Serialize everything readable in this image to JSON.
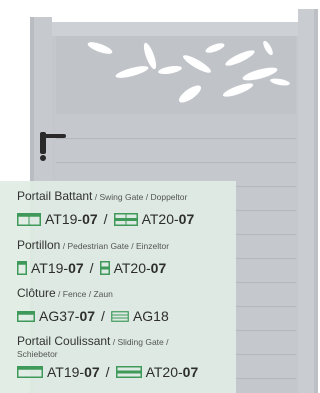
{
  "colors": {
    "gate_gray": "#c7cbd0",
    "gate_frame": "#bfc3c8",
    "panel_bg": "#dfece3",
    "icon_green": "#3f9a5a",
    "text": "#333333"
  },
  "sections": [
    {
      "title": "Portail Battant",
      "subtitle": " / Swing Gate / Doppeltor",
      "subtitle2": "",
      "refs": [
        {
          "icon": "double-swing-gate-icon",
          "code": "AT19-",
          "bold": "07"
        },
        {
          "icon": "double-swing-gate-split-icon",
          "code": "AT20-",
          "bold": "07"
        }
      ]
    },
    {
      "title": "Portillon",
      "subtitle": " / Pedestrian Gate / Einzeltor",
      "subtitle2": "",
      "refs": [
        {
          "icon": "pedestrian-gate-icon",
          "code": "AT19-",
          "bold": "07"
        },
        {
          "icon": "pedestrian-gate-split-icon",
          "code": "AT20-",
          "bold": "07"
        }
      ]
    },
    {
      "title": "Clôture",
      "subtitle": " / Fence / Zaun",
      "subtitle2": "",
      "refs": [
        {
          "icon": "fence-panel-icon",
          "code": "AG37-",
          "bold": "07"
        },
        {
          "icon": "fence-slat-icon",
          "code": "AG18",
          "bold": ""
        }
      ]
    },
    {
      "title": "Portail Coulissant",
      "subtitle": " / Sliding Gate /",
      "subtitle2": "Schiebetor",
      "refs": [
        {
          "icon": "sliding-gate-icon",
          "code": "AT19-",
          "bold": "07"
        },
        {
          "icon": "sliding-gate-split-icon",
          "code": "AT20-",
          "bold": "07"
        }
      ]
    }
  ],
  "separator": "/"
}
